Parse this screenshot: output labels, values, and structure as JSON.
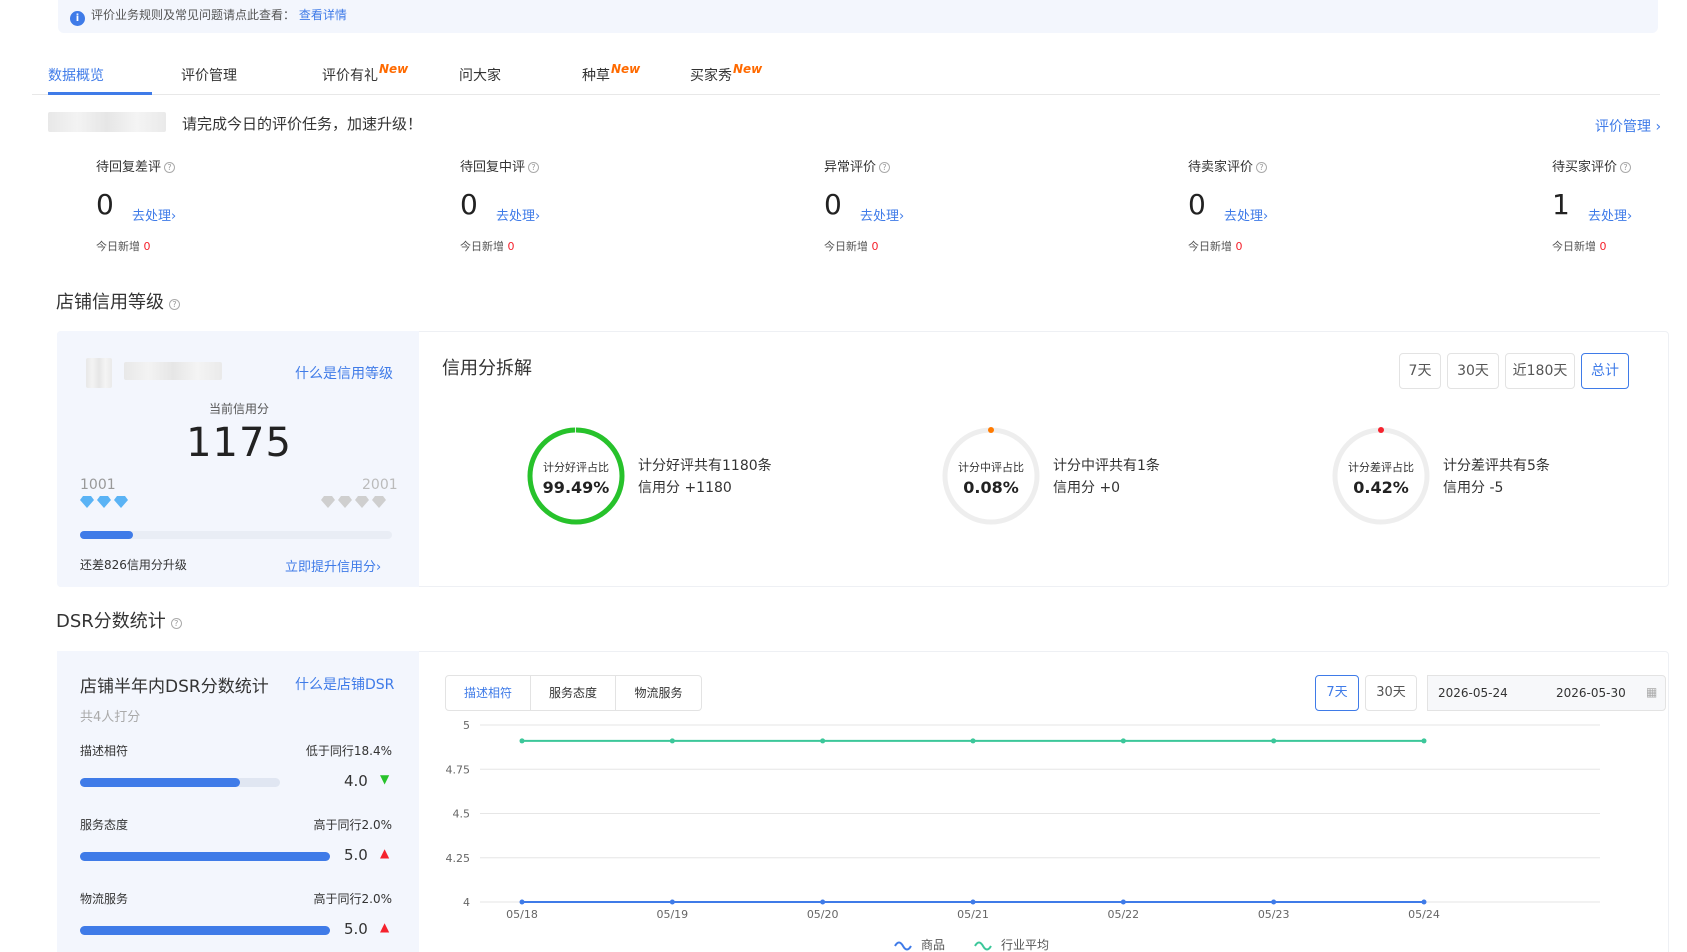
{
  "notice": {
    "text": "评价业务规则及常见问题请点此查看：",
    "link": "查看详情"
  },
  "tabs": [
    {
      "label": "数据概览"
    },
    {
      "label": "评价管理"
    },
    {
      "label": "评价有礼",
      "badge": "New"
    },
    {
      "label": "问大家"
    },
    {
      "label": "种草",
      "badge": "New"
    },
    {
      "label": "买家秀",
      "badge": "New"
    }
  ],
  "task": {
    "text": "请完成今日的评价任务，加速升级！",
    "manage_link": "评价管理 ›"
  },
  "stats": [
    {
      "label": "待回复差评",
      "value": "0",
      "action": "去处理›",
      "today_label": "今日新增",
      "today_value": "0"
    },
    {
      "label": "待回复中评",
      "value": "0",
      "action": "去处理›",
      "today_label": "今日新增",
      "today_value": "0"
    },
    {
      "label": "异常评价",
      "value": "0",
      "action": "去处理›",
      "today_label": "今日新增",
      "today_value": "0"
    },
    {
      "label": "待卖家评价",
      "value": "0",
      "action": "去处理›",
      "today_label": "今日新增",
      "today_value": "0"
    },
    {
      "label": "待买家评价",
      "value": "1",
      "action": "去处理›",
      "today_label": "今日新增",
      "today_value": "0"
    }
  ],
  "credit": {
    "section_title": "店铺信用等级",
    "what_link": "什么是信用等级",
    "current_label": "当前信用分",
    "score": "1175",
    "range_min": "1001",
    "range_max": "2001",
    "progress_fraction": 0.17,
    "gap_text": "还差826信用分升级",
    "upgrade_link": "立即提升信用分›",
    "breakdown_title": "信用分拆解",
    "periods": [
      "7天",
      "30天",
      "近180天",
      "总计"
    ],
    "active_period": "总计",
    "rings": [
      {
        "label": "计分好评占比",
        "value": "99.49%",
        "fraction": 0.9949,
        "color": "#27c22b",
        "line1": "计分好评共有1180条",
        "line2": "信用分 +1180"
      },
      {
        "label": "计分中评占比",
        "value": "0.08%",
        "fraction": 0.0008,
        "color": "#ff7a00",
        "line1": "计分中评共有1条",
        "line2": "信用分 +0"
      },
      {
        "label": "计分差评占比",
        "value": "0.42%",
        "fraction": 0.0042,
        "color": "#f5222d",
        "line1": "计分差评共有5条",
        "line2": "信用分 -5"
      }
    ]
  },
  "dsr": {
    "section_title": "DSR分数统计",
    "panel_title": "店铺半年内DSR分数统计",
    "what_link": "什么是店铺DSR",
    "raters": "共4人打分",
    "items": [
      {
        "name": "描述相符",
        "compare": "低于同行18.4%",
        "score": "4.0",
        "value": 4.0,
        "trend": "down"
      },
      {
        "name": "服务态度",
        "compare": "高于同行2.0%",
        "score": "5.0",
        "value": 5.0,
        "trend": "up"
      },
      {
        "name": "物流服务",
        "compare": "高于同行2.0%",
        "score": "5.0",
        "value": 5.0,
        "trend": "up"
      }
    ],
    "chart_tabs": [
      "描述相符",
      "服务态度",
      "物流服务"
    ],
    "active_chart_tab": "描述相符",
    "periods": [
      "7天",
      "30天"
    ],
    "active_period": "7天",
    "date_start": "2026-05-24",
    "date_end": "2026-05-30"
  },
  "chart_data": {
    "type": "line",
    "x": [
      "05/18",
      "05/19",
      "05/20",
      "05/21",
      "05/22",
      "05/23",
      "05/24"
    ],
    "yticks": [
      "5",
      "4.75",
      "4.5",
      "4.25",
      "4"
    ],
    "ylim": [
      4,
      5
    ],
    "series": [
      {
        "name": "商品",
        "values": [
          4,
          4,
          4,
          4,
          4,
          4,
          4
        ],
        "color": "#3f7be8"
      },
      {
        "name": "行业平均",
        "values": [
          4.91,
          4.91,
          4.91,
          4.91,
          4.91,
          4.91,
          4.91
        ],
        "color": "#3cc79a"
      }
    ],
    "legend": "bottom"
  }
}
